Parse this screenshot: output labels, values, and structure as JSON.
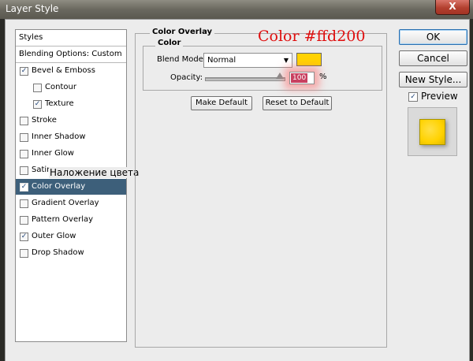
{
  "window": {
    "title": "Layer Style",
    "close_label": "X"
  },
  "sidebar": {
    "styles_label": "Styles",
    "blending_label": "Blending Options: Custom",
    "items": [
      {
        "label": "Bevel & Emboss",
        "checked": true,
        "indent": false,
        "active": false
      },
      {
        "label": "Contour",
        "checked": false,
        "indent": true,
        "active": false
      },
      {
        "label": "Texture",
        "checked": true,
        "indent": true,
        "active": false
      },
      {
        "label": "Stroke",
        "checked": false,
        "indent": false,
        "active": false
      },
      {
        "label": "Inner Shadow",
        "checked": false,
        "indent": false,
        "active": false
      },
      {
        "label": "Inner Glow",
        "checked": false,
        "indent": false,
        "active": false
      },
      {
        "label": "Satin",
        "checked": false,
        "indent": false,
        "active": false
      },
      {
        "label": "Color Overlay",
        "checked": true,
        "indent": false,
        "active": true
      },
      {
        "label": "Gradient Overlay",
        "checked": false,
        "indent": false,
        "active": false
      },
      {
        "label": "Pattern Overlay",
        "checked": false,
        "indent": false,
        "active": false
      },
      {
        "label": "Outer Glow",
        "checked": true,
        "indent": false,
        "active": false
      },
      {
        "label": "Drop Shadow",
        "checked": false,
        "indent": false,
        "active": false
      }
    ]
  },
  "annotations": {
    "ru_label": "Наложение цвета",
    "color_label": "Color #ffd200"
  },
  "color_overlay": {
    "group_title": "Color Overlay",
    "sub_title": "Color",
    "blend_mode_label": "Blend Mode:",
    "blend_mode_value": "Normal",
    "opacity_label": "Opacity:",
    "opacity_value": "100",
    "opacity_unit": "%",
    "opacity_fraction": 1.0,
    "swatch_color": "#ffd200",
    "make_default": "Make Default",
    "reset_default": "Reset to Default"
  },
  "buttons": {
    "ok": "OK",
    "cancel": "Cancel",
    "new_style": "New Style...",
    "preview_label": "Preview",
    "preview_checked": true
  },
  "colors": {
    "active_row": "#3d5f7a",
    "overlay": "#ffd200",
    "annotation_red": "#e00e0e"
  }
}
